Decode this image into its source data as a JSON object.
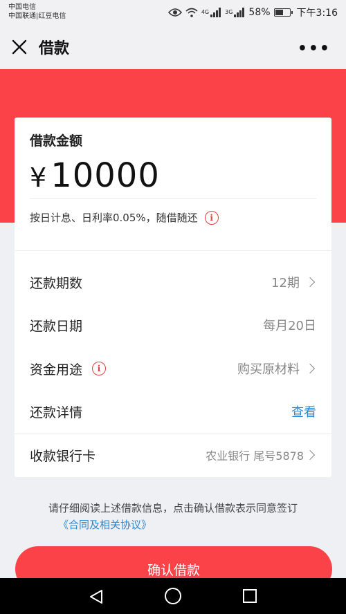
{
  "status_bar": {
    "carrier1": "中国电信",
    "carrier2": "中国联通|红豆电信",
    "network1": "4G",
    "network2": "3G",
    "battery": "58%",
    "battery_level": 0.58,
    "time": "下午3:16"
  },
  "nav": {
    "title": "借款",
    "more": "•••"
  },
  "card": {
    "amount_label": "借款金额",
    "currency": "¥",
    "amount": "10000",
    "rate_text": "按日计息、日利率0.05%，随借随还",
    "rows": [
      {
        "label": "还款期数",
        "value": "12期"
      },
      {
        "label": "还款日期",
        "value": "每月20日"
      },
      {
        "label": "资金用途",
        "value": "购买原材料"
      },
      {
        "label": "还款详情",
        "value": "查看"
      },
      {
        "label": "收款银行卡",
        "value": "农业银行 尾号5878"
      }
    ]
  },
  "notice": {
    "text": "请仔细阅读上述借款信息，点击确认借款表示同意签订",
    "link": "《合同及相关协议》"
  },
  "confirm_button": "确认借款",
  "colors": {
    "accent": "#fb4248",
    "link": "#2a8ad3",
    "info": "#e53c3c"
  }
}
